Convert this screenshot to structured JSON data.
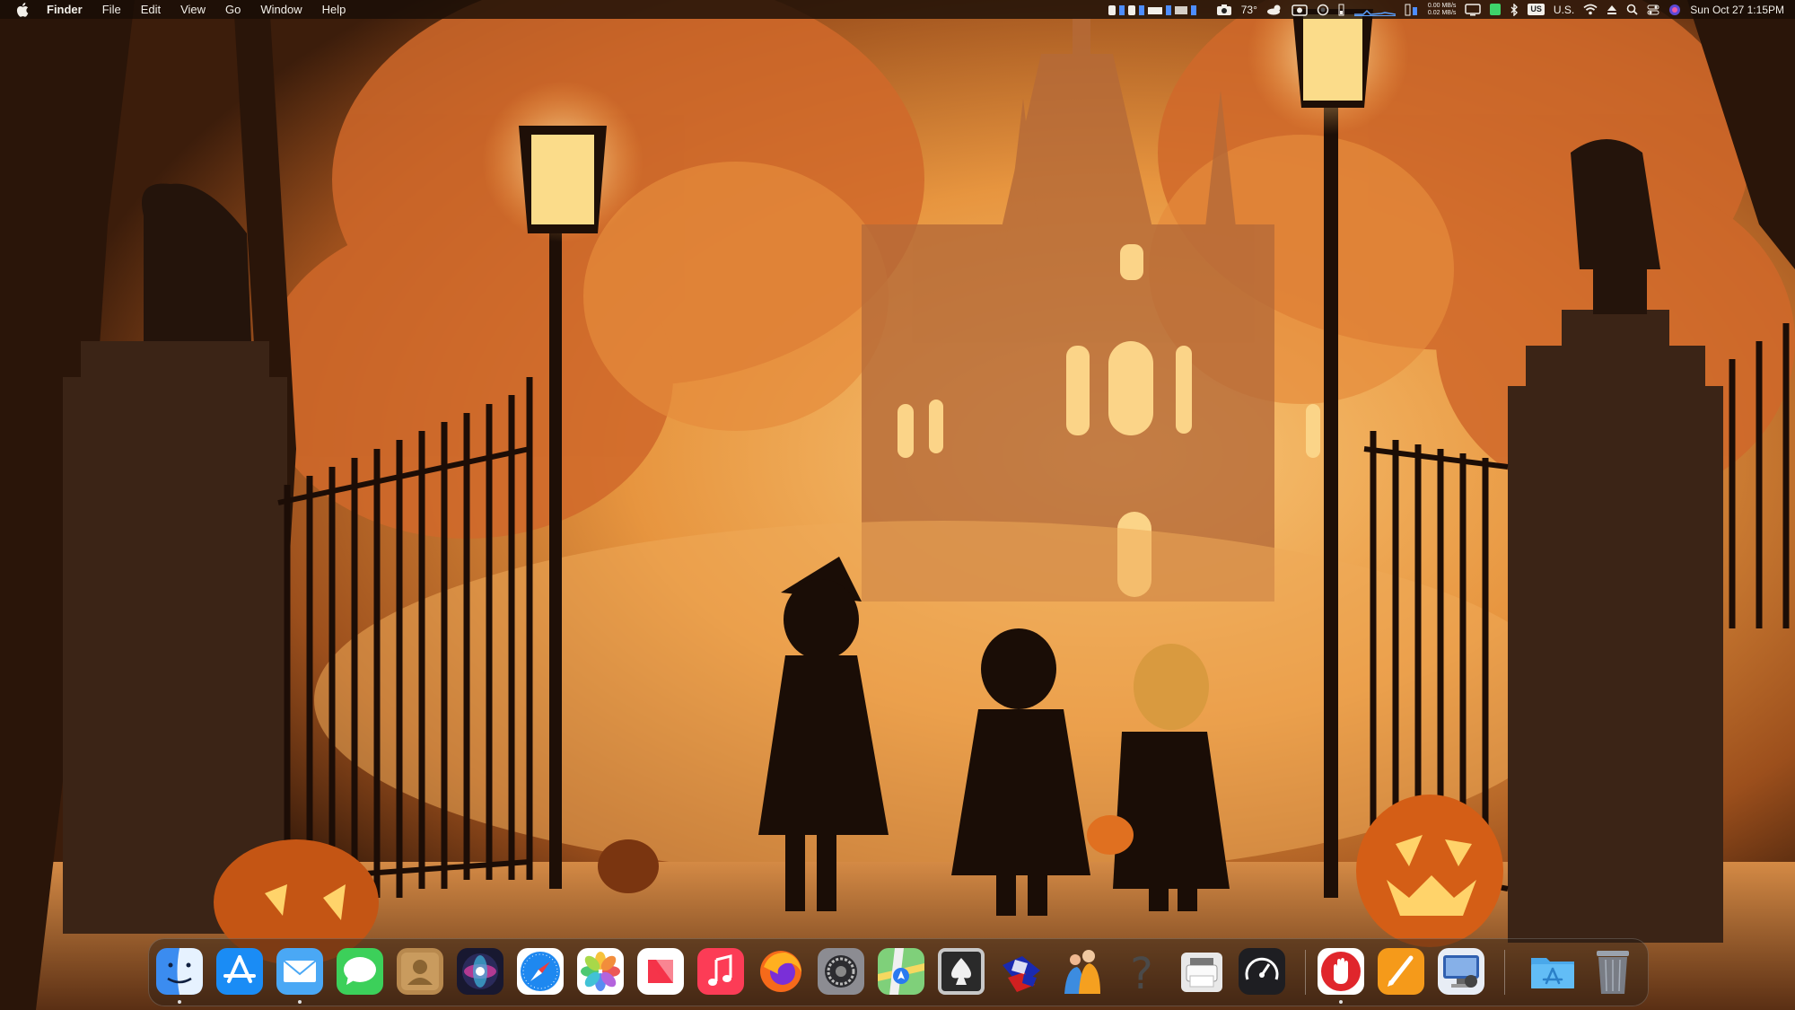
{
  "menubar": {
    "app_name": "Finder",
    "menus": [
      "File",
      "Edit",
      "View",
      "Go",
      "Window",
      "Help"
    ],
    "status": {
      "temperature": "73°",
      "network_up": "0.00 MB/s",
      "network_down": "0.02 MB/s",
      "keyboard_layout": "U.S.",
      "keyboard_badge": "US",
      "clock": "Sun Oct 27  1:15PM"
    }
  },
  "dock": {
    "apps": [
      {
        "name": "finder-icon",
        "running": true
      },
      {
        "name": "app-store-icon",
        "running": false
      },
      {
        "name": "mail-icon",
        "running": true
      },
      {
        "name": "messages-icon",
        "running": false
      },
      {
        "name": "contacts-icon",
        "running": false
      },
      {
        "name": "siri-icon",
        "running": false
      },
      {
        "name": "safari-icon",
        "running": false
      },
      {
        "name": "photos-icon",
        "running": false
      },
      {
        "name": "news-icon",
        "running": false
      },
      {
        "name": "music-icon",
        "running": false
      },
      {
        "name": "firefox-icon",
        "running": false
      },
      {
        "name": "system-settings-icon",
        "running": false
      },
      {
        "name": "maps-icon",
        "running": false
      },
      {
        "name": "solitaire-icon",
        "running": false
      },
      {
        "name": "chess-icon",
        "running": false
      },
      {
        "name": "family-icon",
        "running": false
      },
      {
        "name": "help-icon",
        "running": false
      },
      {
        "name": "printer-icon",
        "running": false
      },
      {
        "name": "activity-gauge-icon",
        "running": false
      },
      {
        "name": "stop-hand-icon",
        "running": true
      },
      {
        "name": "pages-icon",
        "running": false
      },
      {
        "name": "screen-app-icon",
        "running": false
      },
      {
        "name": "applications-folder-icon",
        "running": false
      },
      {
        "name": "trash-icon",
        "running": false
      }
    ]
  },
  "colors": {
    "menubar_bg": "#180e06",
    "sky_glow": "#f5b860",
    "foliage": "#d8742a",
    "silhouette": "#1a0d06",
    "pumpkin": "#e06a1a"
  }
}
